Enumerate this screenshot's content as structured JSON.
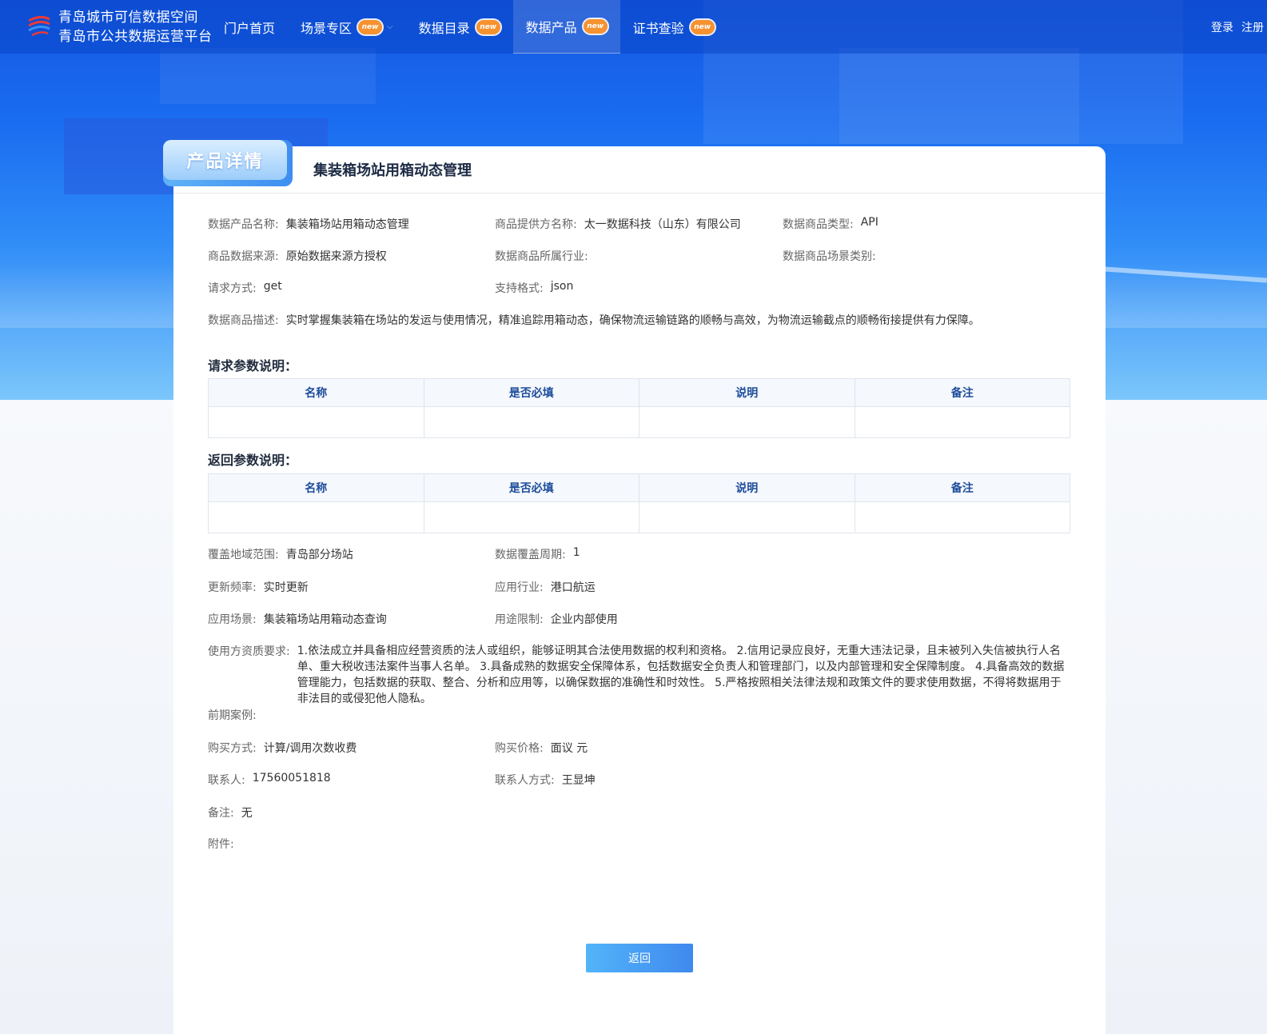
{
  "header": {
    "brand_line1": "青岛城市可信数据空间",
    "brand_line2": "青岛市公共数据运营平台",
    "nav": [
      {
        "label": "门户首页"
      },
      {
        "label": "场景专区",
        "badge": "new"
      },
      {
        "label": "数据目录",
        "badge": "new"
      },
      {
        "label": "数据产品",
        "badge": "new"
      },
      {
        "label": "证书查验",
        "badge": "new"
      }
    ],
    "login": "登录",
    "register": "注册"
  },
  "detail": {
    "tab_label": "产品详情",
    "title": "集装箱场站用箱动态管理",
    "fields": {
      "product_name_label": "数据产品名称:",
      "product_name": "集装箱场站用箱动态管理",
      "provider_label": "商品提供方名称:",
      "provider": "太一数据科技（山东）有限公司",
      "type_label": "数据商品类型:",
      "type": "API",
      "source_label": "商品数据来源:",
      "source": "原始数据来源方授权",
      "industry_label": "数据商品所属行业:",
      "industry": "",
      "scene_cat_label": "数据商品场景类别:",
      "scene_cat": "",
      "method_label": "请求方式:",
      "method": "get",
      "format_label": "支持格式:",
      "format": "json",
      "desc_label": "数据商品描述:",
      "desc": "实时掌握集装箱在场站的发运与使用情况，精准追踪用箱动态，确保物流运输链路的顺畅与高效，为物流运输截点的顺畅衔接提供有力保障。"
    },
    "request_params_title": "请求参数说明：",
    "response_params_title": "返回参数说明：",
    "param_columns": [
      "名称",
      "是否必填",
      "说明",
      "备注"
    ],
    "fields2": {
      "region_label": "覆盖地域范围:",
      "region": "青岛部分场站",
      "period_label": "数据覆盖周期:",
      "period": "1",
      "freq_label": "更新频率:",
      "freq": "实时更新",
      "app_industry_label": "应用行业:",
      "app_industry": "港口航运",
      "app_scene_label": "应用场景:",
      "app_scene": "集装箱场站用箱动态查询",
      "usage_limit_label": "用途限制:",
      "usage_limit": "企业内部使用",
      "qualification_label": "使用方资质要求:",
      "qualification": "1.依法成立并具备相应经营资质的法人或组织，能够证明其合法使用数据的权利和资格。 2.信用记录应良好，无重大违法记录，且未被列入失信被执行人名单、重大税收违法案件当事人名单。 3.具备成熟的数据安全保障体系，包括数据安全负责人和管理部门，以及内部管理和安全保障制度。 4.具备高效的数据管理能力，包括数据的获取、整合、分析和应用等，以确保数据的准确性和时效性。 5.严格按照相关法律法规和政策文件的要求使用数据，不得将数据用于非法目的或侵犯他人隐私。",
      "cases_label": "前期案例:",
      "cases": "",
      "purchase_label": "购买方式:",
      "purchase": "计算/调用次数收费",
      "price_label": "购买价格:",
      "price": "面议 元",
      "contact_label": "联系人:",
      "contact": "17560051818",
      "contact_method_label": "联系人方式:",
      "contact_method": "王显坤",
      "remark_label": "备注:",
      "remark": "无",
      "attachment_label": "附件:"
    },
    "return_button": "返回"
  },
  "colors": {
    "nav_bg": "#0a46c8",
    "badge": "#f6922f",
    "accent": "#3f89ee",
    "th_text": "#1d4c9b"
  }
}
